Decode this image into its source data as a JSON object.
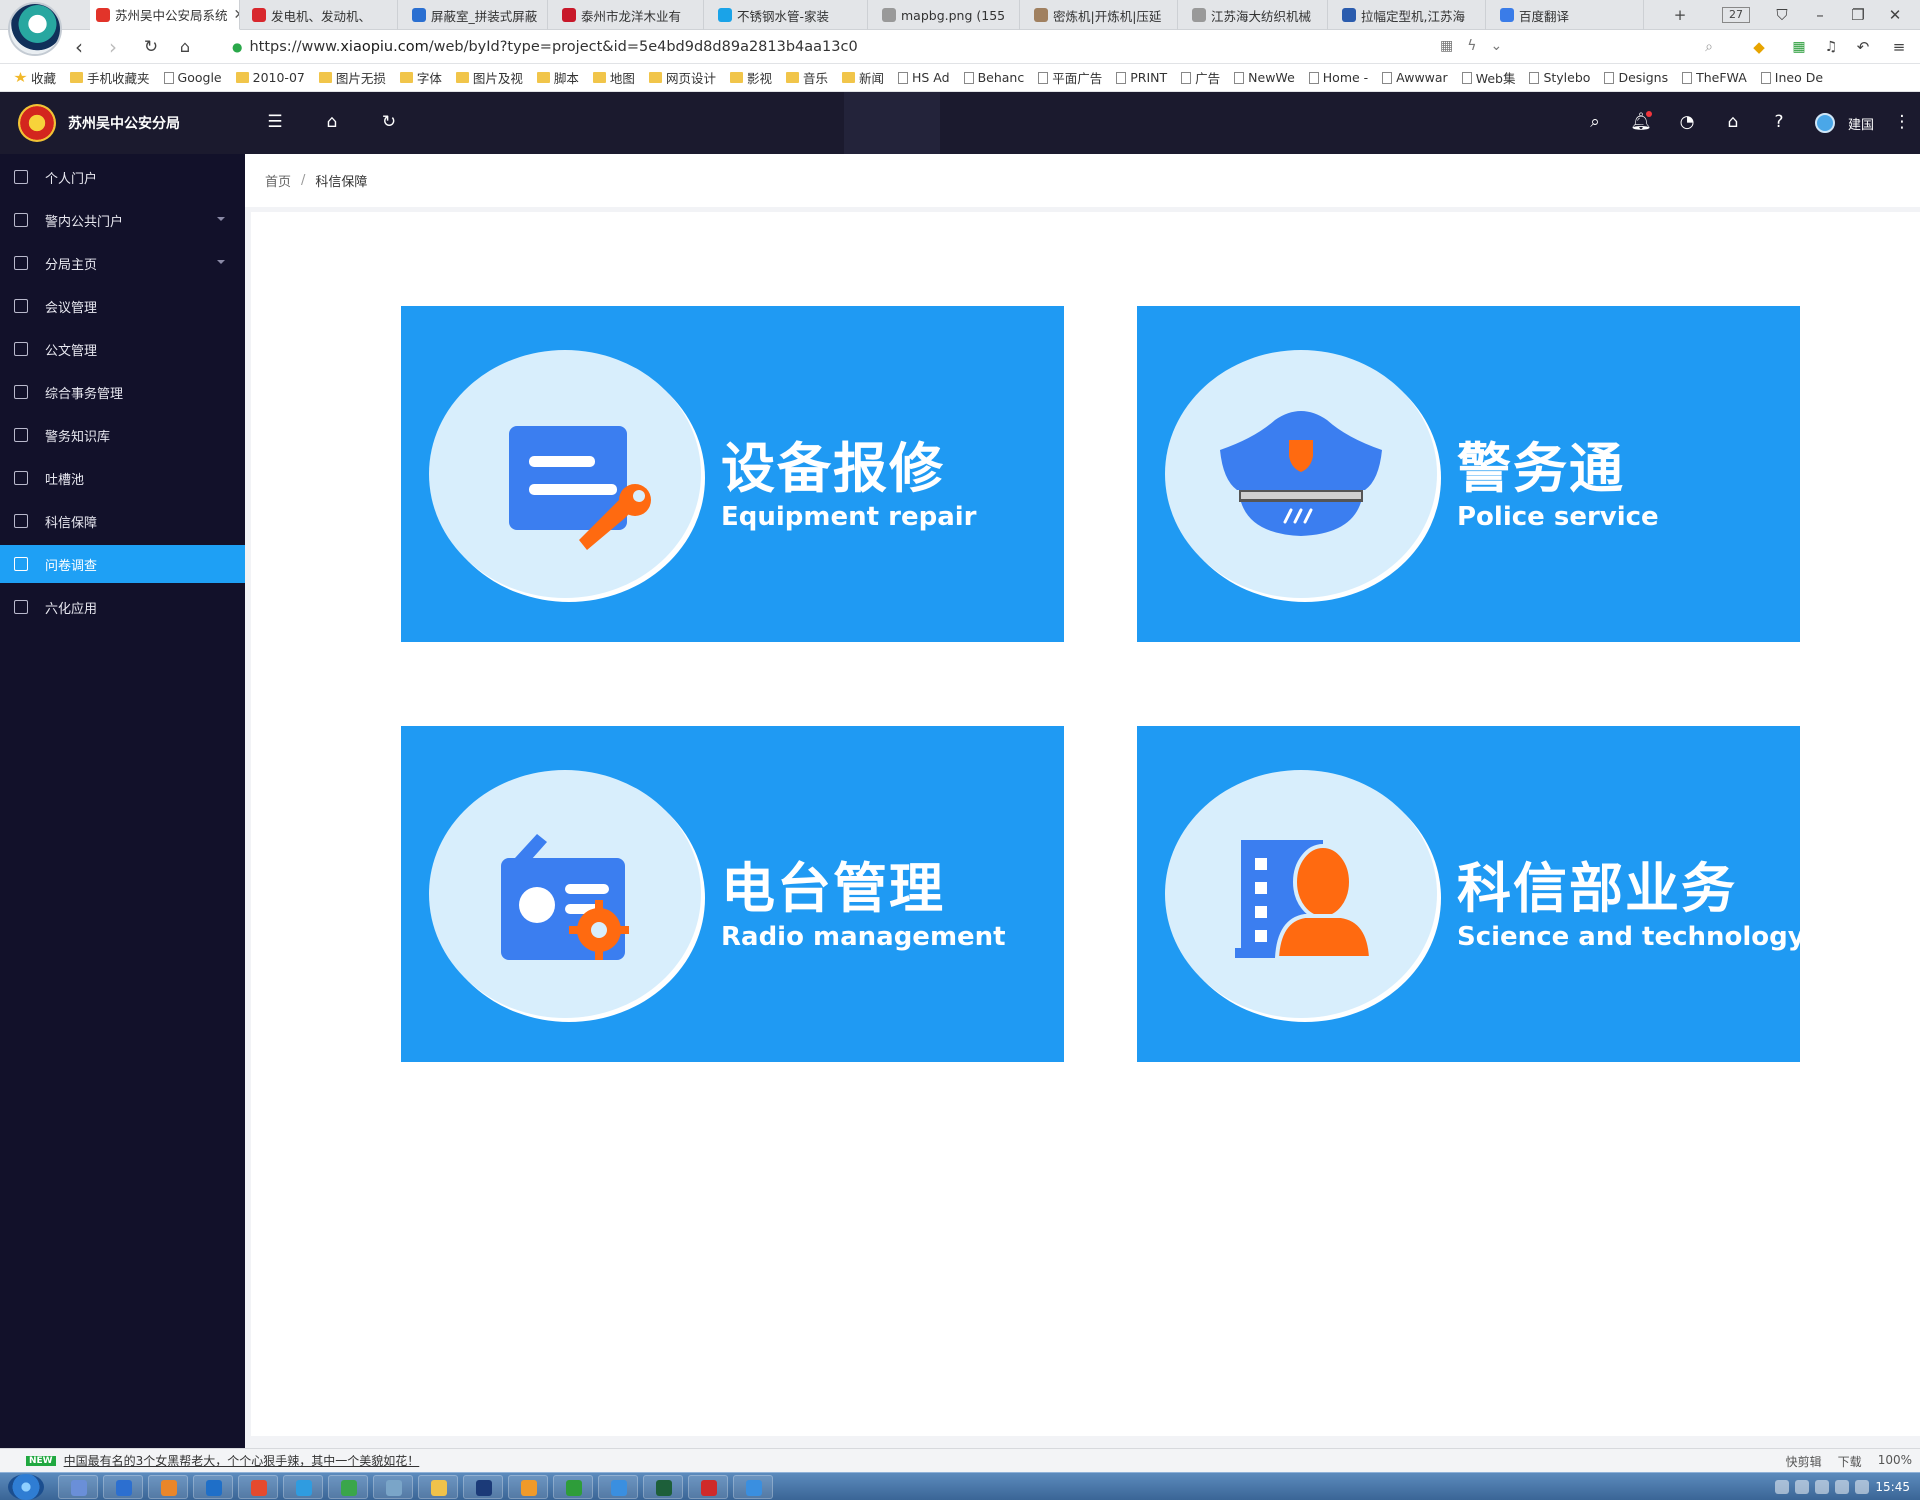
{
  "browser": {
    "tabs": [
      {
        "label": "苏州吴中公安局系统",
        "active": true,
        "color": "#e2342a"
      },
      {
        "label": "发电机、发动机、",
        "active": false,
        "color": "#d8272d"
      },
      {
        "label": "屏蔽室_拼装式屏蔽",
        "active": false,
        "color": "#2a6fd1"
      },
      {
        "label": "泰州市龙洋木业有",
        "active": false,
        "color": "#c8182a"
      },
      {
        "label": "不锈钢水管-家装",
        "active": false,
        "color": "#1aa3e8"
      },
      {
        "label": "mapbg.png (155",
        "active": false,
        "color": "#999999"
      },
      {
        "label": "密炼机|开炼机|压延",
        "active": false,
        "color": "#a08060"
      },
      {
        "label": "江苏海大纺织机械",
        "active": false,
        "color": "#999999"
      },
      {
        "label": "拉幅定型机,江苏海",
        "active": false,
        "color": "#2b5cae"
      },
      {
        "label": "百度翻译",
        "active": false,
        "color": "#3a7ce8"
      }
    ],
    "tab_count": "27",
    "url_prefix": "https://www.",
    "url_domain": "xiaopiu.com",
    "url_path": "/web/byId?type=project&id=5e4bd9d8d89a2813b4aa13c0",
    "bookmarks": [
      {
        "label": "收藏",
        "type": "star"
      },
      {
        "label": "手机收藏夹",
        "type": "folder"
      },
      {
        "label": "Google",
        "type": "page"
      },
      {
        "label": "2010-07",
        "type": "folder"
      },
      {
        "label": "图片无损",
        "type": "folder"
      },
      {
        "label": "字体",
        "type": "folder"
      },
      {
        "label": "图片及视",
        "type": "folder"
      },
      {
        "label": "脚本",
        "type": "folder"
      },
      {
        "label": "地图",
        "type": "folder"
      },
      {
        "label": "网页设计",
        "type": "folder"
      },
      {
        "label": "影视",
        "type": "folder"
      },
      {
        "label": "音乐",
        "type": "folder"
      },
      {
        "label": "新闻",
        "type": "folder"
      },
      {
        "label": "HS Ad",
        "type": "page"
      },
      {
        "label": "Behanc",
        "type": "page"
      },
      {
        "label": "平面广告",
        "type": "page"
      },
      {
        "label": "PRINT",
        "type": "page"
      },
      {
        "label": "广告",
        "type": "page"
      },
      {
        "label": "NewWe",
        "type": "page"
      },
      {
        "label": "Home -",
        "type": "page"
      },
      {
        "label": "Awwwar",
        "type": "page"
      },
      {
        "label": "Web集",
        "type": "page"
      },
      {
        "label": "Stylebo",
        "type": "page"
      },
      {
        "label": "Designs",
        "type": "page"
      },
      {
        "label": "TheFWA",
        "type": "page"
      },
      {
        "label": "Ineo De",
        "type": "page"
      }
    ]
  },
  "app": {
    "title": "苏州吴中公安分局",
    "user_name": "建国",
    "accent": "#1ea0f5",
    "card_blue": "#1f9af3",
    "icon_orange": "#ff6a10"
  },
  "sidebar": {
    "items": [
      {
        "label": "个人门户",
        "icon": "portal-icon",
        "active": false,
        "has_submenu": false
      },
      {
        "label": "警内公共门户",
        "icon": "public-portal-icon",
        "active": false,
        "has_submenu": true
      },
      {
        "label": "分局主页",
        "icon": "homepage-icon",
        "active": false,
        "has_submenu": true
      },
      {
        "label": "会议管理",
        "icon": "meeting-icon",
        "active": false,
        "has_submenu": false
      },
      {
        "label": "公文管理",
        "icon": "document-icon",
        "active": false,
        "has_submenu": false
      },
      {
        "label": "综合事务管理",
        "icon": "affairs-icon",
        "active": false,
        "has_submenu": false
      },
      {
        "label": "警务知识库",
        "icon": "knowledge-icon",
        "active": false,
        "has_submenu": false
      },
      {
        "label": "吐槽池",
        "icon": "feedback-icon",
        "active": false,
        "has_submenu": false
      },
      {
        "label": "科信保障",
        "icon": "tech-support-icon",
        "active": false,
        "has_submenu": false
      },
      {
        "label": "问卷调查",
        "icon": "survey-icon",
        "active": true,
        "has_submenu": false
      },
      {
        "label": "六化应用",
        "icon": "app-icon",
        "active": false,
        "has_submenu": false
      }
    ]
  },
  "breadcrumb": {
    "home": "首页",
    "separator": "/",
    "current": "科信保障"
  },
  "cards": [
    {
      "title_zh": "设备报修",
      "title_en": "Equipment repair",
      "icon": "equipment-repair-icon"
    },
    {
      "title_zh": "警务通",
      "title_en": "Police service",
      "icon": "police-cap-icon"
    },
    {
      "title_zh": "电台管理",
      "title_en": "Radio management",
      "icon": "radio-icon"
    },
    {
      "title_zh": "科信部业务",
      "title_en": "Science and technology",
      "icon": "tech-staff-icon"
    }
  ],
  "statusbar": {
    "news_badge": "NEW",
    "news_text": "中国最有名的3个女黑帮老大，个个心狠手辣，其中一个美貌如花！",
    "right_items": [
      "快剪辑",
      "下载",
      "100%"
    ]
  },
  "taskbar": {
    "clock": "15:45"
  }
}
